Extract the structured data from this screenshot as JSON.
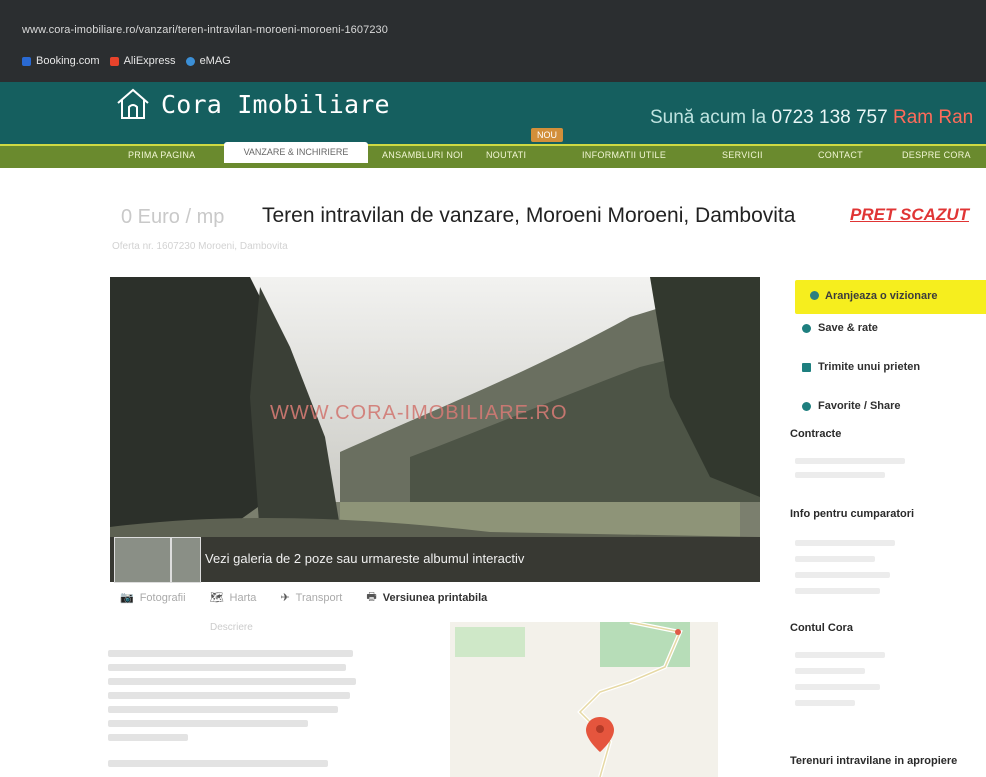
{
  "browser": {
    "url": "www.cora-imobiliare.ro/vanzari/teren-intravilan-moroeni-moroeni-1607230",
    "bookmarks": [
      {
        "label": "Booking.com",
        "icon": "booking-icon",
        "color": "#2a6ad3"
      },
      {
        "label": "AliExpress",
        "icon": "aliexpress-icon",
        "color": "#e8432b"
      },
      {
        "label": "eMAG",
        "icon": "emag-icon",
        "color": "#3b8fd6"
      }
    ]
  },
  "header": {
    "logo_text": "Cora Imobiliare",
    "phone_prefix": "Sună acum la ",
    "phone_number": "0723 138 757",
    "phone_tail": " Ram  Ran",
    "badge": "NOU"
  },
  "nav": {
    "items": [
      {
        "label": "PRIMA PAGINA"
      },
      {
        "label": "VANZARE & INCHIRIERE"
      },
      {
        "label": "ANSAMBLURI NOI"
      },
      {
        "label": "NOUTATI"
      },
      {
        "label": "INFORMATII UTILE"
      },
      {
        "label": "SERVICII"
      },
      {
        "label": "CONTACT"
      },
      {
        "label": "DESPRE CORA"
      }
    ],
    "active_index": 1
  },
  "listing": {
    "price": "0 Euro / mp",
    "title": "Teren intravilan de vanzare, Moroeni Moroeni, Dambovita",
    "price_tag": "PRET SCAZUT",
    "subline": "Oferta nr. 1607230      Moroeni, Dambovita",
    "watermark": "WWW.CORA-IMOBILIARE.RO",
    "gallery_text": "Vezi galeria de 2 poze sau urmareste albumul interactiv"
  },
  "photo_tools": [
    {
      "label": "Fotografii",
      "icon": "camera-icon"
    },
    {
      "label": "Harta",
      "icon": "map-icon"
    },
    {
      "label": "Transport",
      "icon": "bus-icon"
    },
    {
      "label": "Versiunea printabila",
      "icon": "printer-icon"
    }
  ],
  "description": {
    "heading": "Descriere"
  },
  "sidebar": {
    "cta": "Aranjeaza o vizionare",
    "links": [
      {
        "label": "Save & rate",
        "icon": "heart-icon"
      },
      {
        "label": "Trimite unui prieten",
        "icon": "mail-icon"
      },
      {
        "label": "Favorite / Share",
        "icon": "star-icon"
      }
    ],
    "sections": [
      {
        "title": "Contracte"
      },
      {
        "title": "Info pentru cumparatori"
      },
      {
        "title": "Contul Cora"
      },
      {
        "title": "Terenuri intravilane in apropiere"
      }
    ]
  }
}
